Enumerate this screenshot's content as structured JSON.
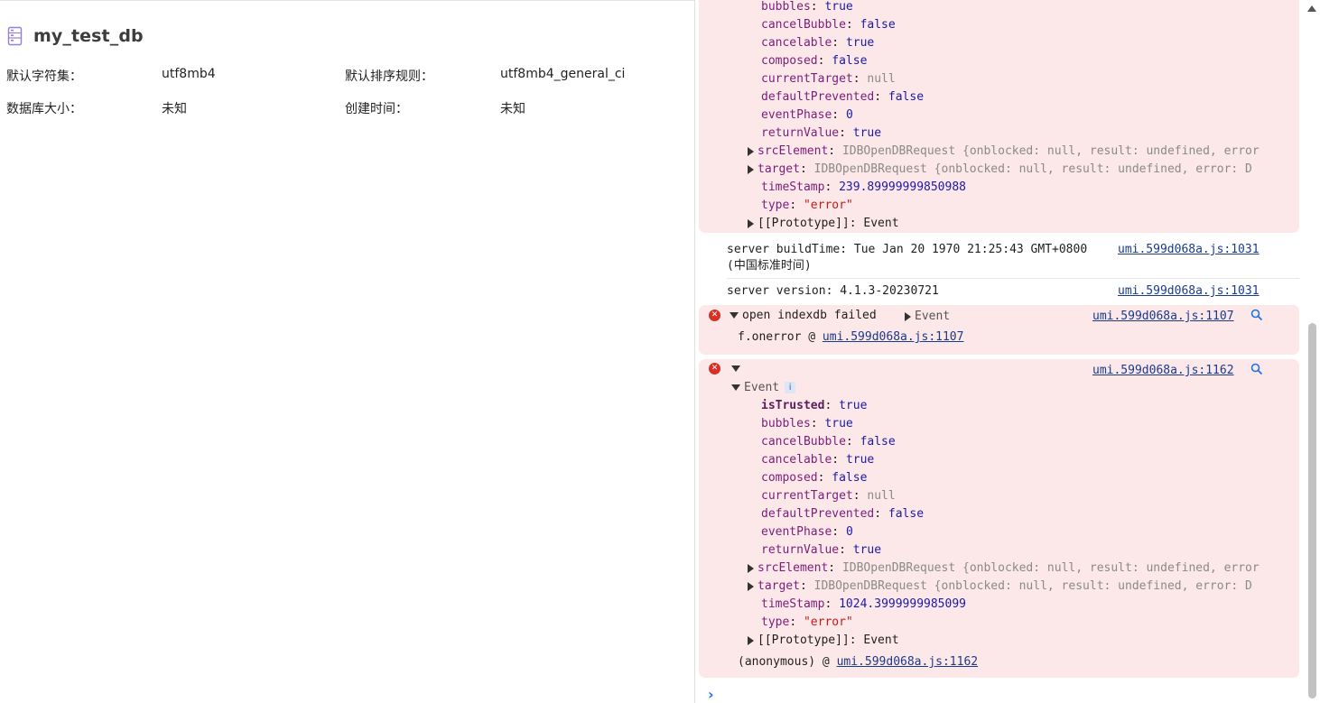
{
  "database": {
    "name": "my_test_db",
    "fields": [
      {
        "label": "默认字符集：",
        "value": "utf8mb4"
      },
      {
        "label": "默认排序规则：",
        "value": "utf8mb4_general_ci"
      },
      {
        "label": "数据库大小：",
        "value": "未知"
      },
      {
        "label": "创建时间：",
        "value": "未知"
      }
    ]
  },
  "console": {
    "event1_tail": {
      "bubbles": "true",
      "cancelBubble": "false",
      "cancelable": "true",
      "composed": "false",
      "currentTarget": "null",
      "defaultPrevented": "false",
      "eventPhase": "0",
      "returnValue": "true",
      "srcElement": "IDBOpenDBRequest {onblocked: null, result: undefined, error",
      "target": "IDBOpenDBRequest {onblocked: null, result: undefined, error: D",
      "timeStamp": "239.89999999850988",
      "type": "\"error\"",
      "prototype": "[[Prototype]]: Event"
    },
    "log_build": {
      "line1": "server buildTime: Tue Jan 20 1970 21:25:43 GMT+0800",
      "line2": "(中国标准时间)",
      "source": "umi.599d068a.js:1031"
    },
    "log_version": {
      "text": "server version: 4.1.3-20230721",
      "source": "umi.599d068a.js:1031"
    },
    "error1": {
      "message": "open indexdb failed",
      "event_label": "Event",
      "source": "umi.599d068a.js:1107",
      "trace_fn": "f.onerror @ ",
      "trace_source": "umi.599d068a.js:1107"
    },
    "error2": {
      "source": "umi.599d068a.js:1162",
      "event_label": "Event",
      "info_badge": "i",
      "isTrusted": "true",
      "bubbles": "true",
      "cancelBubble": "false",
      "cancelable": "true",
      "composed": "false",
      "currentTarget": "null",
      "defaultPrevented": "false",
      "eventPhase": "0",
      "returnValue": "true",
      "srcElement": "IDBOpenDBRequest {onblocked: null, result: undefined, error",
      "target": "IDBOpenDBRequest {onblocked: null, result: undefined, error: D",
      "timeStamp": "1024.3999999985099",
      "type": "\"error\"",
      "prototype": "[[Prototype]]: Event",
      "trace_fn": "(anonymous) @ ",
      "trace_source": "umi.599d068a.js:1162"
    }
  },
  "colors": {
    "error_bg": "#fce8e8",
    "error_icon": "#d93025",
    "link": "#1a3a8a",
    "accent": "#1a73e8"
  }
}
